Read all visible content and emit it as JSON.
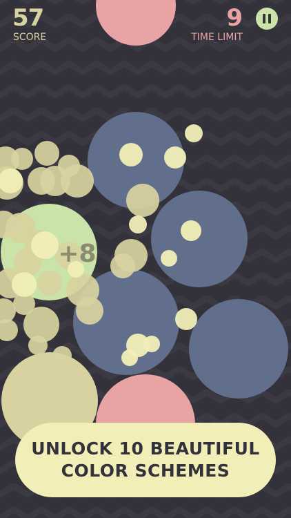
{
  "hud": {
    "score_value": "57",
    "score_label": "SCORE",
    "time_value": "9",
    "time_label": "TIME LIMIT"
  },
  "game": {
    "bonus_popup": "+8"
  },
  "promo": {
    "line1": "UNLOCK 10 BEAUTIFUL",
    "line2": "COLOR SCHEMES"
  },
  "colors": {
    "background": "#33323a",
    "wave": "#3b3a43",
    "blue_circle": "#626f8c",
    "pink_circle": "#e8a3a5",
    "green_circle": "#c9e3a8",
    "cream_circle": "#d8d2a0",
    "yellow_dot": "#f1eeb7",
    "popup_text": "#8d8a72",
    "promo_bg": "#f1eeb7",
    "promo_text": "#33323a"
  },
  "icons": {
    "pause": "pause-icon"
  }
}
